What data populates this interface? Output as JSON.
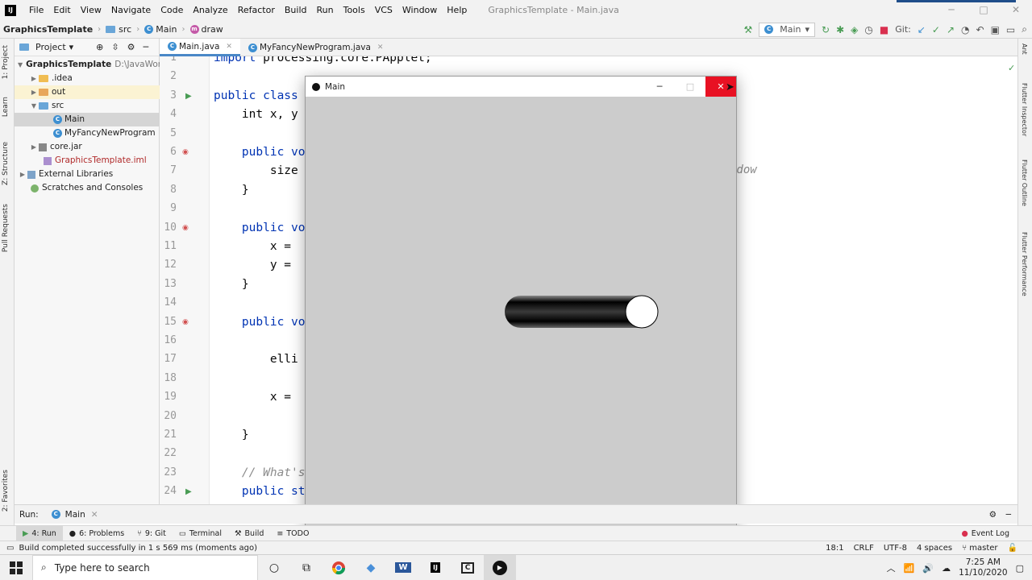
{
  "menubar": {
    "items": [
      "File",
      "Edit",
      "View",
      "Navigate",
      "Code",
      "Analyze",
      "Refactor",
      "Build",
      "Run",
      "Tools",
      "VCS",
      "Window",
      "Help"
    ],
    "window_title": "GraphicsTemplate - Main.java"
  },
  "navbar": {
    "project": "GraphicsTemplate",
    "crumb_src": "src",
    "crumb_class": "Main",
    "crumb_method": "draw",
    "run_config": "Main",
    "git_label": "Git:"
  },
  "left_tabs": [
    "1: Project",
    "Learn",
    "Z: Structure",
    "Pull Requests",
    "2: Favorites"
  ],
  "right_tabs": [
    "Ant",
    "Flutter Inspector",
    "Flutter Outline",
    "Flutter Performance"
  ],
  "project_panel": {
    "header": "Project",
    "tree": [
      {
        "label": "GraphicsTemplate",
        "suffix": "D:\\JavaWork"
      },
      {
        "label": ".idea"
      },
      {
        "label": "out"
      },
      {
        "label": "src"
      },
      {
        "label": "Main"
      },
      {
        "label": "MyFancyNewProgram"
      },
      {
        "label": "core.jar"
      },
      {
        "label": "GraphicsTemplate.iml"
      },
      {
        "label": "External Libraries"
      },
      {
        "label": "Scratches and Consoles"
      }
    ]
  },
  "editor": {
    "tabs": [
      {
        "label": "Main.java"
      },
      {
        "label": "MyFancyNewProgram.java"
      }
    ],
    "line_numbers": [
      "1",
      "2",
      "3",
      "4",
      "5",
      "6",
      "7",
      "8",
      "9",
      "10",
      "11",
      "12",
      "13",
      "14",
      "15",
      "16",
      "17",
      "18",
      "19",
      "20",
      "21",
      "22",
      "23",
      "24"
    ],
    "lines": [
      {
        "kw": "import",
        "text": " processing.core.PApplet;"
      },
      {
        "kw": "",
        "text": ""
      },
      {
        "kw": "public class",
        "text": ""
      },
      {
        "kw": "",
        "text": "    int x, y"
      },
      {
        "kw": "",
        "text": ""
      },
      {
        "kw": "    public vo",
        "text": ""
      },
      {
        "kw": "",
        "text": "        size"
      },
      {
        "kw": "",
        "text": "    }"
      },
      {
        "kw": "",
        "text": ""
      },
      {
        "kw": "    public vo",
        "text": ""
      },
      {
        "kw": "",
        "text": "        x = "
      },
      {
        "kw": "",
        "text": "        y = "
      },
      {
        "kw": "",
        "text": "    }"
      },
      {
        "kw": "",
        "text": ""
      },
      {
        "kw": "    public vo",
        "text": ""
      },
      {
        "kw": "",
        "text": ""
      },
      {
        "kw": "",
        "text": "        elli"
      },
      {
        "kw": "",
        "text": ""
      },
      {
        "kw": "",
        "text": "        x = "
      },
      {
        "kw": "",
        "text": ""
      },
      {
        "kw": "",
        "text": "    }"
      },
      {
        "kw": "",
        "text": ""
      },
      {
        "kw": "",
        "text": "    // What's",
        "comment": true
      },
      {
        "kw": "    public st",
        "text": ""
      }
    ],
    "right_fragment": "ndow"
  },
  "app_window": {
    "title": "Main",
    "minimize": "─",
    "maximize": "□",
    "close": "✕"
  },
  "runbar": {
    "label": "Run:",
    "config": "Main"
  },
  "tooltabs": [
    "4: Run",
    "6: Problems",
    "9: Git",
    "Terminal",
    "Build",
    "TODO"
  ],
  "event_log": "Event Log",
  "status": {
    "message": "Build completed successfully in 1 s 569 ms (moments ago)",
    "position": "18:1",
    "line_sep": "CRLF",
    "encoding": "UTF-8",
    "indent": "4 spaces",
    "branch": "master"
  },
  "taskbar": {
    "search_placeholder": "Type here to search",
    "time": "7:25 AM",
    "date": "11/10/2020"
  }
}
